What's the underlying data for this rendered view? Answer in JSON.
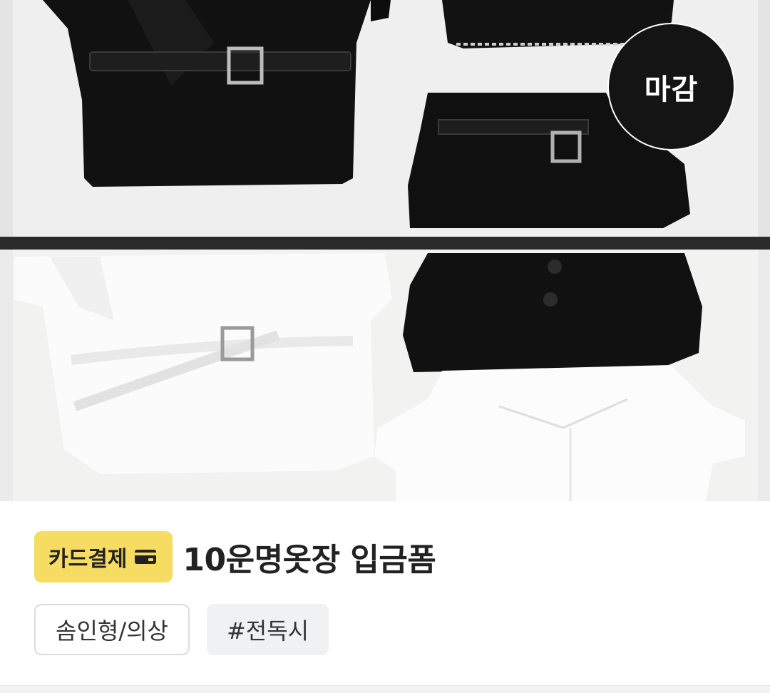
{
  "product": {
    "status_badge": "마감",
    "payment_badge": "카드결제",
    "payment_icon": "credit-card-icon",
    "title": "10운명옷장 입금폼",
    "tags": [
      "솜인형/의상",
      "#전독시"
    ]
  },
  "colors": {
    "payment_badge_bg": "#f6dc63",
    "status_badge_bg": "#141414",
    "hashtag_bg": "#f0f1f3"
  }
}
